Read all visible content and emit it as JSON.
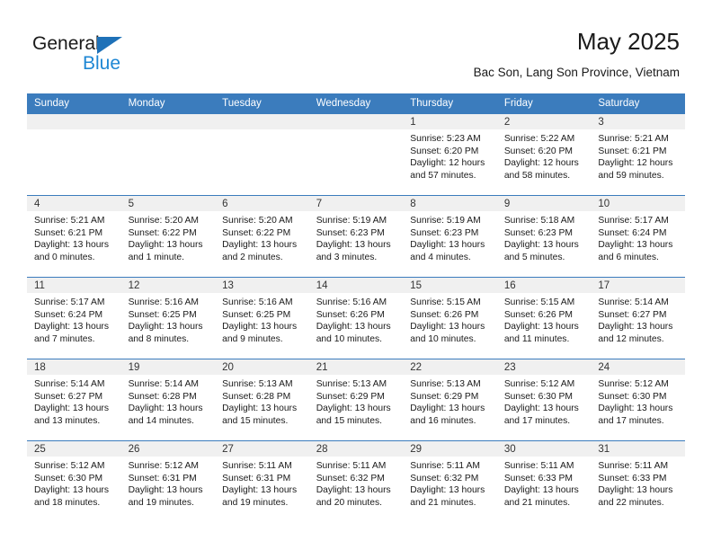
{
  "brand": {
    "line1": "General",
    "line2": "Blue",
    "triangle_icon": "triangle-icon",
    "accent_dark": "#1e71b8",
    "accent_light": "#1e87d4"
  },
  "header": {
    "title": "May 2025",
    "subtitle": "Bac Son, Lang Son Province, Vietnam"
  },
  "calendar": {
    "header_bg": "#3b7cbd",
    "daynum_bg": "#f0f0f0",
    "weekday_headers": [
      "Sunday",
      "Monday",
      "Tuesday",
      "Wednesday",
      "Thursday",
      "Friday",
      "Saturday"
    ],
    "weeks": [
      [
        {
          "day": "",
          "empty": true
        },
        {
          "day": "",
          "empty": true
        },
        {
          "day": "",
          "empty": true
        },
        {
          "day": "",
          "empty": true
        },
        {
          "day": "1",
          "sunrise": "Sunrise: 5:23 AM",
          "sunset": "Sunset: 6:20 PM",
          "daylight": "Daylight: 12 hours and 57 minutes."
        },
        {
          "day": "2",
          "sunrise": "Sunrise: 5:22 AM",
          "sunset": "Sunset: 6:20 PM",
          "daylight": "Daylight: 12 hours and 58 minutes."
        },
        {
          "day": "3",
          "sunrise": "Sunrise: 5:21 AM",
          "sunset": "Sunset: 6:21 PM",
          "daylight": "Daylight: 12 hours and 59 minutes."
        }
      ],
      [
        {
          "day": "4",
          "sunrise": "Sunrise: 5:21 AM",
          "sunset": "Sunset: 6:21 PM",
          "daylight": "Daylight: 13 hours and 0 minutes."
        },
        {
          "day": "5",
          "sunrise": "Sunrise: 5:20 AM",
          "sunset": "Sunset: 6:22 PM",
          "daylight": "Daylight: 13 hours and 1 minute."
        },
        {
          "day": "6",
          "sunrise": "Sunrise: 5:20 AM",
          "sunset": "Sunset: 6:22 PM",
          "daylight": "Daylight: 13 hours and 2 minutes."
        },
        {
          "day": "7",
          "sunrise": "Sunrise: 5:19 AM",
          "sunset": "Sunset: 6:23 PM",
          "daylight": "Daylight: 13 hours and 3 minutes."
        },
        {
          "day": "8",
          "sunrise": "Sunrise: 5:19 AM",
          "sunset": "Sunset: 6:23 PM",
          "daylight": "Daylight: 13 hours and 4 minutes."
        },
        {
          "day": "9",
          "sunrise": "Sunrise: 5:18 AM",
          "sunset": "Sunset: 6:23 PM",
          "daylight": "Daylight: 13 hours and 5 minutes."
        },
        {
          "day": "10",
          "sunrise": "Sunrise: 5:17 AM",
          "sunset": "Sunset: 6:24 PM",
          "daylight": "Daylight: 13 hours and 6 minutes."
        }
      ],
      [
        {
          "day": "11",
          "sunrise": "Sunrise: 5:17 AM",
          "sunset": "Sunset: 6:24 PM",
          "daylight": "Daylight: 13 hours and 7 minutes."
        },
        {
          "day": "12",
          "sunrise": "Sunrise: 5:16 AM",
          "sunset": "Sunset: 6:25 PM",
          "daylight": "Daylight: 13 hours and 8 minutes."
        },
        {
          "day": "13",
          "sunrise": "Sunrise: 5:16 AM",
          "sunset": "Sunset: 6:25 PM",
          "daylight": "Daylight: 13 hours and 9 minutes."
        },
        {
          "day": "14",
          "sunrise": "Sunrise: 5:16 AM",
          "sunset": "Sunset: 6:26 PM",
          "daylight": "Daylight: 13 hours and 10 minutes."
        },
        {
          "day": "15",
          "sunrise": "Sunrise: 5:15 AM",
          "sunset": "Sunset: 6:26 PM",
          "daylight": "Daylight: 13 hours and 10 minutes."
        },
        {
          "day": "16",
          "sunrise": "Sunrise: 5:15 AM",
          "sunset": "Sunset: 6:26 PM",
          "daylight": "Daylight: 13 hours and 11 minutes."
        },
        {
          "day": "17",
          "sunrise": "Sunrise: 5:14 AM",
          "sunset": "Sunset: 6:27 PM",
          "daylight": "Daylight: 13 hours and 12 minutes."
        }
      ],
      [
        {
          "day": "18",
          "sunrise": "Sunrise: 5:14 AM",
          "sunset": "Sunset: 6:27 PM",
          "daylight": "Daylight: 13 hours and 13 minutes."
        },
        {
          "day": "19",
          "sunrise": "Sunrise: 5:14 AM",
          "sunset": "Sunset: 6:28 PM",
          "daylight": "Daylight: 13 hours and 14 minutes."
        },
        {
          "day": "20",
          "sunrise": "Sunrise: 5:13 AM",
          "sunset": "Sunset: 6:28 PM",
          "daylight": "Daylight: 13 hours and 15 minutes."
        },
        {
          "day": "21",
          "sunrise": "Sunrise: 5:13 AM",
          "sunset": "Sunset: 6:29 PM",
          "daylight": "Daylight: 13 hours and 15 minutes."
        },
        {
          "day": "22",
          "sunrise": "Sunrise: 5:13 AM",
          "sunset": "Sunset: 6:29 PM",
          "daylight": "Daylight: 13 hours and 16 minutes."
        },
        {
          "day": "23",
          "sunrise": "Sunrise: 5:12 AM",
          "sunset": "Sunset: 6:30 PM",
          "daylight": "Daylight: 13 hours and 17 minutes."
        },
        {
          "day": "24",
          "sunrise": "Sunrise: 5:12 AM",
          "sunset": "Sunset: 6:30 PM",
          "daylight": "Daylight: 13 hours and 17 minutes."
        }
      ],
      [
        {
          "day": "25",
          "sunrise": "Sunrise: 5:12 AM",
          "sunset": "Sunset: 6:30 PM",
          "daylight": "Daylight: 13 hours and 18 minutes."
        },
        {
          "day": "26",
          "sunrise": "Sunrise: 5:12 AM",
          "sunset": "Sunset: 6:31 PM",
          "daylight": "Daylight: 13 hours and 19 minutes."
        },
        {
          "day": "27",
          "sunrise": "Sunrise: 5:11 AM",
          "sunset": "Sunset: 6:31 PM",
          "daylight": "Daylight: 13 hours and 19 minutes."
        },
        {
          "day": "28",
          "sunrise": "Sunrise: 5:11 AM",
          "sunset": "Sunset: 6:32 PM",
          "daylight": "Daylight: 13 hours and 20 minutes."
        },
        {
          "day": "29",
          "sunrise": "Sunrise: 5:11 AM",
          "sunset": "Sunset: 6:32 PM",
          "daylight": "Daylight: 13 hours and 21 minutes."
        },
        {
          "day": "30",
          "sunrise": "Sunrise: 5:11 AM",
          "sunset": "Sunset: 6:33 PM",
          "daylight": "Daylight: 13 hours and 21 minutes."
        },
        {
          "day": "31",
          "sunrise": "Sunrise: 5:11 AM",
          "sunset": "Sunset: 6:33 PM",
          "daylight": "Daylight: 13 hours and 22 minutes."
        }
      ]
    ]
  }
}
